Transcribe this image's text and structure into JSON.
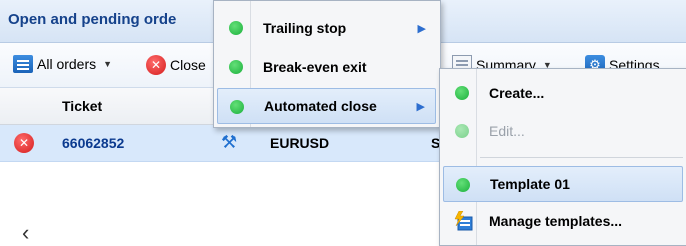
{
  "panel": {
    "title": "Open and pending orde"
  },
  "toolbar": {
    "all_orders_label": "All orders",
    "close_label": "Close",
    "summary_label": "Summary",
    "settings_label": "Settings"
  },
  "table": {
    "header": {
      "ticket": "Ticket"
    },
    "rows": [
      {
        "ticket": "66062852",
        "symbol": "EURUSD",
        "type": "S"
      }
    ]
  },
  "context_menu": {
    "items": [
      {
        "label": "Trailing stop",
        "icon": "green-dot-icon",
        "has_submenu": true
      },
      {
        "label": "Break-even exit",
        "icon": "green-dot-icon",
        "has_submenu": false
      },
      {
        "label": "Automated close",
        "icon": "green-dot-icon",
        "has_submenu": true,
        "active": true
      }
    ]
  },
  "submenu": {
    "items": [
      {
        "label": "Create...",
        "icon": "green-dot-icon",
        "enabled": true
      },
      {
        "label": "Edit...",
        "icon": "green-dot-icon",
        "enabled": false
      },
      {
        "label": "Template 01",
        "icon": "green-dot-icon",
        "enabled": true,
        "highlighted": true
      },
      {
        "label": "Manage templates...",
        "icon": "manage-templates-icon",
        "enabled": true
      }
    ]
  },
  "colors": {
    "accent_blue": "#15428b",
    "ticket_blue": "#0b3a8f",
    "status_green": "#1cb13c",
    "close_red": "#d41c1c",
    "row_selected": "#d8e8fb"
  }
}
